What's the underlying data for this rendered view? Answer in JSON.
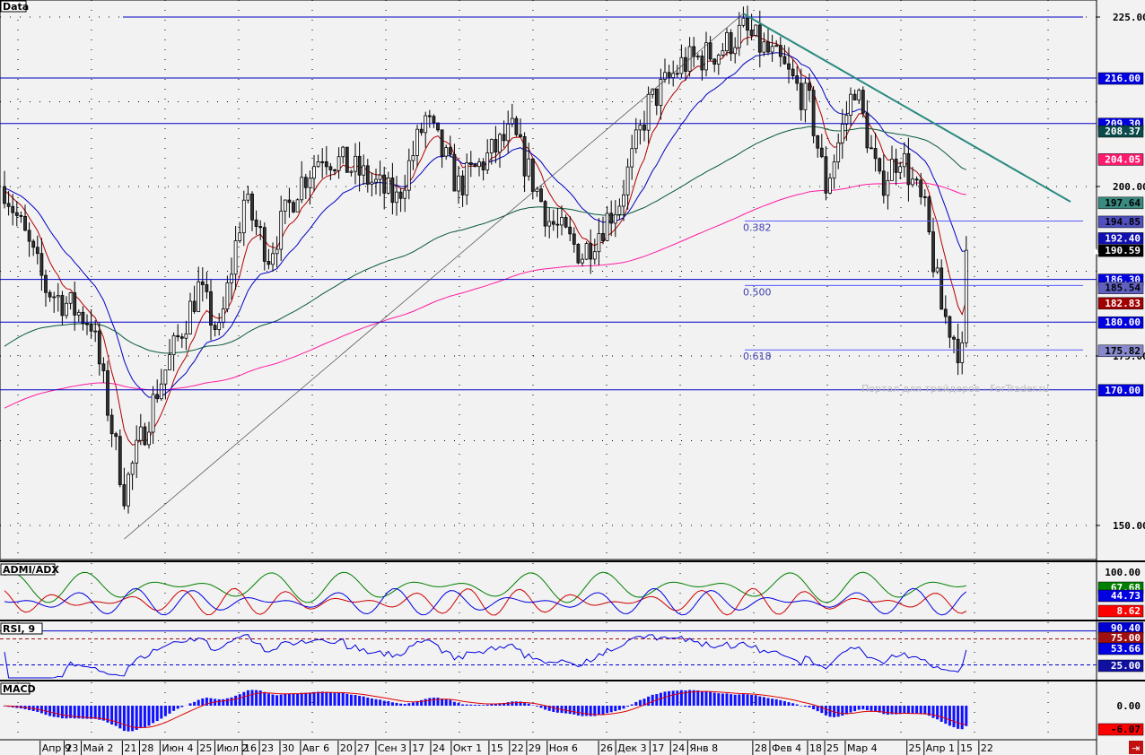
{
  "chart_data": {
    "type": "candlestick",
    "symbol_label": "Data",
    "ylim": [
      147,
      227
    ],
    "y_ticks": [
      "225.00",
      "200.00",
      "175.00",
      "150.00"
    ],
    "x_labels": [
      "Апр 9",
      "23",
      "Май 2",
      "21",
      "28",
      "Июн 4",
      "25",
      "Июл 2",
      "16",
      "23",
      "30",
      "Авг 6",
      "20",
      "27",
      "Сен 3",
      "17",
      "24",
      "Окт 1",
      "15",
      "22",
      "29",
      "Ноя 6",
      "26",
      "Дек 3",
      "17",
      "24",
      "Янв 8",
      "28",
      "Фев 4",
      "18",
      "25",
      "Мар 4",
      "25",
      "Апр 1",
      "15",
      "22"
    ],
    "x_label_bars": [
      7,
      14,
      19,
      31,
      36,
      42,
      53,
      58,
      66,
      71,
      77,
      83,
      94,
      99,
      105,
      115,
      121,
      127,
      138,
      144,
      149,
      155,
      170,
      175,
      185,
      191,
      196,
      215,
      220,
      231,
      236,
      242,
      260,
      265,
      275,
      281
    ],
    "price_keypoints": [
      [
        0,
        200
      ],
      [
        10,
        185
      ],
      [
        21,
        180
      ],
      [
        29,
        155
      ],
      [
        37,
        170
      ],
      [
        47,
        185
      ],
      [
        52,
        178
      ],
      [
        58,
        198
      ],
      [
        64,
        190
      ],
      [
        71,
        200
      ],
      [
        77,
        205
      ],
      [
        86,
        202
      ],
      [
        95,
        198
      ],
      [
        102,
        210
      ],
      [
        110,
        200
      ],
      [
        123,
        208
      ],
      [
        132,
        195
      ],
      [
        140,
        190
      ],
      [
        149,
        198
      ],
      [
        156,
        212
      ],
      [
        164,
        218
      ],
      [
        173,
        220
      ],
      [
        179,
        223
      ],
      [
        188,
        218
      ],
      [
        195,
        212
      ],
      [
        199,
        200
      ],
      [
        206,
        215
      ],
      [
        212,
        200
      ],
      [
        217,
        205
      ],
      [
        223,
        196
      ],
      [
        227,
        182
      ],
      [
        232,
        175
      ],
      [
        233,
        191
      ]
    ],
    "horizontal_levels": [
      225,
      216,
      209.3,
      180,
      170,
      186.3
    ],
    "fibonacci": [
      {
        "label": "0.382",
        "value": 194.9
      },
      {
        "label": "0.500",
        "value": 185.4
      },
      {
        "label": "0.618",
        "value": 175.9
      }
    ],
    "trendlines": [
      {
        "from": [
          29,
          148
        ],
        "to": [
          179,
          225.5
        ]
      },
      {
        "from": [
          179,
          225.5
        ],
        "to": [
          258,
          198
        ]
      }
    ],
    "price_labels": [
      {
        "text": "216.00",
        "value": 216,
        "bg": "#0000e0",
        "fg": "#ffffff"
      },
      {
        "text": "209.30",
        "value": 209.3,
        "bg": "#0000e0",
        "fg": "#ffffff"
      },
      {
        "text": "208.37",
        "value": 208.2,
        "bg": "#0a4a4a",
        "fg": "#ffffff"
      },
      {
        "text": "204.05",
        "value": 204.05,
        "bg": "#ff1a6e",
        "fg": "#ffffff"
      },
      {
        "text": "197.64",
        "value": 197.64,
        "bg": "#3a8a80",
        "fg": "#000000"
      },
      {
        "text": "194.85",
        "value": 194.85,
        "bg": "#5050c0",
        "fg": "#000000"
      },
      {
        "text": "192.40",
        "value": 192.4,
        "bg": "#1010b0",
        "fg": "#ffffff"
      },
      {
        "text": "190.59",
        "value": 190.59,
        "bg": "#000000",
        "fg": "#ffffff"
      },
      {
        "text": "186.30",
        "value": 186.3,
        "bg": "#0000e0",
        "fg": "#ffffff"
      },
      {
        "text": "185.54",
        "value": 185.1,
        "bg": "#6060c0",
        "fg": "#000000"
      },
      {
        "text": "182.83",
        "value": 182.83,
        "bg": "#a00000",
        "fg": "#ffffff"
      },
      {
        "text": "180.00",
        "value": 180,
        "bg": "#0000e0",
        "fg": "#ffffff"
      },
      {
        "text": "175.82",
        "value": 175.82,
        "bg": "#8888cc",
        "fg": "#000000"
      },
      {
        "text": "170.00",
        "value": 170,
        "bg": "#0000e0",
        "fg": "#ffffff"
      }
    ],
    "watermark": "Портал для трейдеров - ForTrader.ru",
    "indicators": [
      {
        "name": "ADMI/ADX",
        "labels": [
          {
            "text": "100.00",
            "bg": "",
            "fg": "#000000"
          },
          {
            "text": "67.68",
            "bg": "#008000",
            "fg": "#ffffff"
          },
          {
            "text": "44.73",
            "bg": "#0000e0",
            "fg": "#ffffff"
          },
          {
            "text": "8.62",
            "bg": "#ff0000",
            "fg": "#ffffff"
          }
        ]
      },
      {
        "name": "RSI, 9",
        "labels": [
          {
            "text": "90.40",
            "bg": "#0000d0",
            "fg": "#ffffff"
          },
          {
            "text": "75.00",
            "bg": "#a01010",
            "fg": "#ffffff"
          },
          {
            "text": "53.66",
            "bg": "#0000e0",
            "fg": "#ffffff"
          },
          {
            "text": "25.00",
            "bg": "#1010a0",
            "fg": "#ffffff"
          }
        ]
      },
      {
        "name": "MACD",
        "labels": [
          {
            "text": "0.00",
            "bg": "",
            "fg": "#000000"
          },
          {
            "text": "-6.07",
            "bg": "#ff0000",
            "fg": "#000000"
          }
        ]
      }
    ]
  }
}
